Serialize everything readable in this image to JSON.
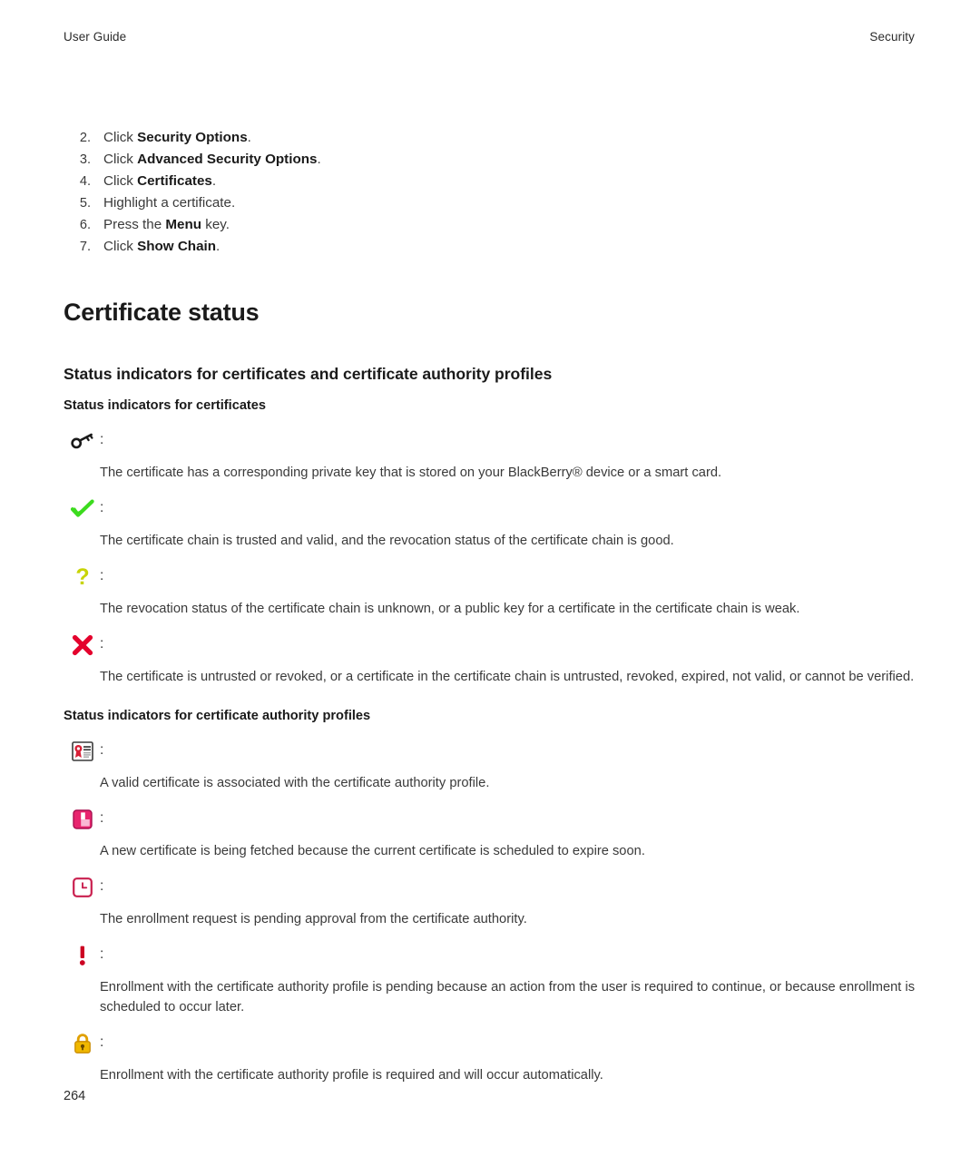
{
  "header": {
    "left": "User Guide",
    "right": "Security"
  },
  "steps": [
    {
      "num": "2.",
      "pre": "Click ",
      "bold": "Security Options",
      "post": "."
    },
    {
      "num": "3.",
      "pre": "Click ",
      "bold": "Advanced Security Options",
      "post": "."
    },
    {
      "num": "4.",
      "pre": "Click ",
      "bold": "Certificates",
      "post": "."
    },
    {
      "num": "5.",
      "pre": "Highlight a certificate.",
      "bold": "",
      "post": ""
    },
    {
      "num": "6.",
      "pre": "Press the ",
      "bold": "Menu",
      "post": " key."
    },
    {
      "num": "7.",
      "pre": "Click ",
      "bold": "Show Chain",
      "post": "."
    }
  ],
  "chapter_title": "Certificate status",
  "section_title": "Status indicators for certificates and certificate authority profiles",
  "subsection_certificates": "Status indicators for certificates",
  "subsection_ca_profiles": "Status indicators for certificate authority profiles",
  "colon": ":",
  "certificate_indicators": [
    {
      "icon": "key-icon",
      "color": "#1a1a1a",
      "text": "The certificate has a corresponding private key that is stored on your BlackBerry® device or a smart card."
    },
    {
      "icon": "check-mark-icon",
      "color": "#3cdb1e",
      "text": "The certificate chain is trusted and valid, and the revocation status of the certificate chain is good."
    },
    {
      "icon": "question-mark-icon",
      "color": "#c8d406",
      "text": "The revocation status of the certificate chain is unknown, or a public key for a certificate in the certificate chain is weak."
    },
    {
      "icon": "x-mark-icon",
      "color": "#e4022d",
      "text": "The certificate is untrusted or revoked, or a certificate in the certificate chain is untrusted, revoked, expired, not valid, or cannot be verified."
    }
  ],
  "ca_profile_indicators": [
    {
      "icon": "certificate-seal-icon",
      "color": "#d81f36",
      "text": "A valid certificate is associated with the certificate authority profile."
    },
    {
      "icon": "fetching-certificate-icon",
      "color": "#e8246e",
      "text": "A new certificate is being fetched because the current certificate is scheduled to expire soon."
    },
    {
      "icon": "pending-clock-icon",
      "color": "#c91f4e",
      "text": "The enrollment request is pending approval from the certificate authority."
    },
    {
      "icon": "exclamation-mark-icon",
      "color": "#cc0022",
      "text": "Enrollment with the certificate authority profile is pending because an action from the user is required to continue, or because enrollment is scheduled to occur later."
    },
    {
      "icon": "padlock-icon",
      "color": "#f0b800",
      "text": "Enrollment with the certificate authority profile is required and will occur automatically."
    }
  ],
  "page_number": "264"
}
